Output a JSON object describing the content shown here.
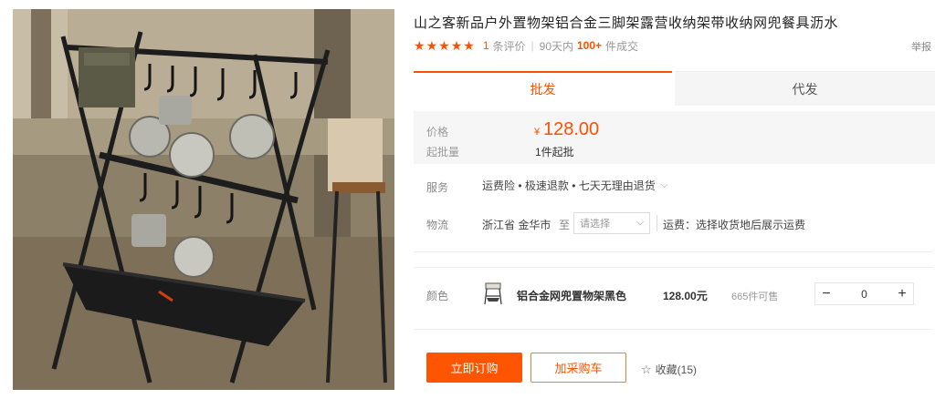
{
  "product": {
    "title": "山之客新品户外置物架铝合金三脚架露营收纳架带收纳网兜餐具沥水",
    "image_icon": "product-photo-camping-rack"
  },
  "rating": {
    "stars": 5,
    "review_count": "1",
    "review_label": "条评价",
    "period": "90天内",
    "deals": "100+",
    "deals_label": "件成交",
    "report": "举报"
  },
  "tabs": [
    {
      "label": "批发"
    },
    {
      "label": "代发"
    }
  ],
  "price": {
    "label": "价格",
    "currency": "¥",
    "value": "128.00",
    "min_label": "起批量",
    "min_value": "1件起批"
  },
  "service": {
    "label": "服务",
    "text": "运费险 • 极速退款 • 七天无理由退货"
  },
  "logistics": {
    "label": "物流",
    "origin": "浙江省 金华市",
    "to": "至",
    "placeholder": "请选择",
    "fee": "运费：选择收货地后展示运费"
  },
  "sku": {
    "label": "颜色",
    "name": "铝合金网兜置物架黑色",
    "price": "128.00元",
    "stock": "665件可售",
    "quantity": "0"
  },
  "actions": {
    "buy": "立即订购",
    "cart": "加采购车",
    "favorite": "收藏(15)"
  },
  "colors": {
    "accent": "#ff5000",
    "buy_button": "#ff5500"
  }
}
